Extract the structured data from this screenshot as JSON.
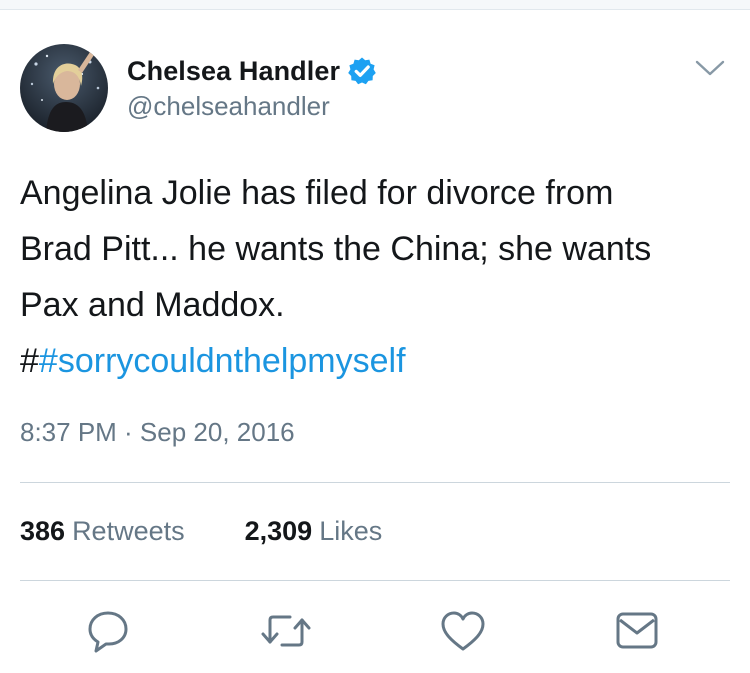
{
  "author": {
    "display_name": "Chelsea Handler",
    "handle": "@chelseahandler",
    "verified": true,
    "avatar_icon": "profile-photo"
  },
  "tweet": {
    "text": "Angelina Jolie has filed for divorce from\nBrad Pitt... he wants the China; she wants\nPax and Maddox.",
    "hashtag_prefix": "#",
    "hashtag": "#sorrycouldnthelpmyself",
    "timestamp": "8:37 PM · Sep 20, 2016"
  },
  "stats": {
    "retweets_count": "386",
    "retweets_label": "Retweets",
    "likes_count": "2,309",
    "likes_label": "Likes"
  },
  "actions": [
    {
      "icon": "reply-icon"
    },
    {
      "icon": "retweet-icon"
    },
    {
      "icon": "like-icon"
    },
    {
      "icon": "direct-message-icon"
    }
  ],
  "colors": {
    "link": "#1b95e0",
    "verified_badge": "#1da1f2",
    "secondary_text": "#657786",
    "icon": "#657786",
    "divider": "#ccd6dd"
  }
}
